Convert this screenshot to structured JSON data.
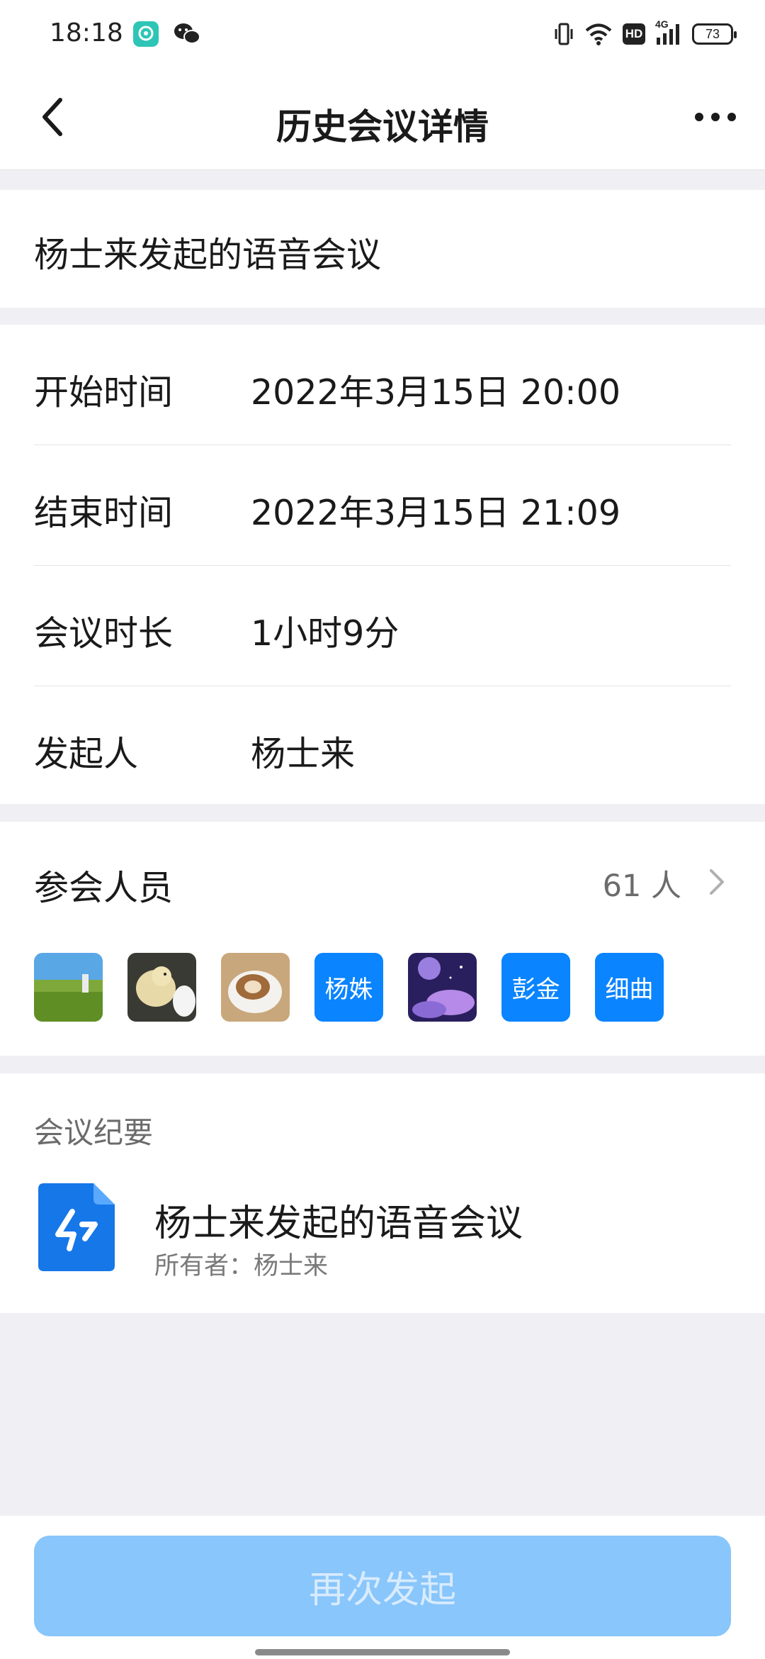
{
  "status_bar": {
    "time": "18:18",
    "network_label": "4G",
    "hd_label": "HD",
    "battery_level": "73",
    "icons": [
      "app-notification-icon",
      "wechat-icon",
      "vibrate-icon",
      "wifi-icon",
      "hd-icon",
      "signal-icon",
      "battery-icon"
    ]
  },
  "nav": {
    "title": "历史会议详情",
    "back_icon": "chevron-left-icon",
    "more_icon": "more-dots-icon"
  },
  "meeting": {
    "title": "杨士来发起的语音会议"
  },
  "details": [
    {
      "label": "开始时间",
      "value": "2022年3月15日 20:00"
    },
    {
      "label": "结束时间",
      "value": "2022年3月15日 21:09"
    },
    {
      "label": "会议时长",
      "value": "1小时9分"
    },
    {
      "label": "发起人",
      "value": "杨士来"
    }
  ],
  "attendees": {
    "title": "参会人员",
    "count": "61 人",
    "avatars": [
      {
        "type": "image",
        "icon": "field-photo"
      },
      {
        "type": "image",
        "icon": "chick-photo"
      },
      {
        "type": "image",
        "icon": "coffee-photo"
      },
      {
        "type": "text",
        "label": "杨姝"
      },
      {
        "type": "image",
        "icon": "night-sky-photo"
      },
      {
        "type": "text",
        "label": "彭金"
      },
      {
        "type": "text",
        "label": "细曲"
      }
    ]
  },
  "notes": {
    "section_label": "会议纪要",
    "doc_title": "杨士来发起的语音会议",
    "owner": "所有者：杨士来"
  },
  "actions": {
    "restart_label": "再次发起"
  },
  "colors": {
    "accent": "#0a84ff",
    "button_disabled": "#88c6fb",
    "page_bg": "#f0f0f4"
  }
}
